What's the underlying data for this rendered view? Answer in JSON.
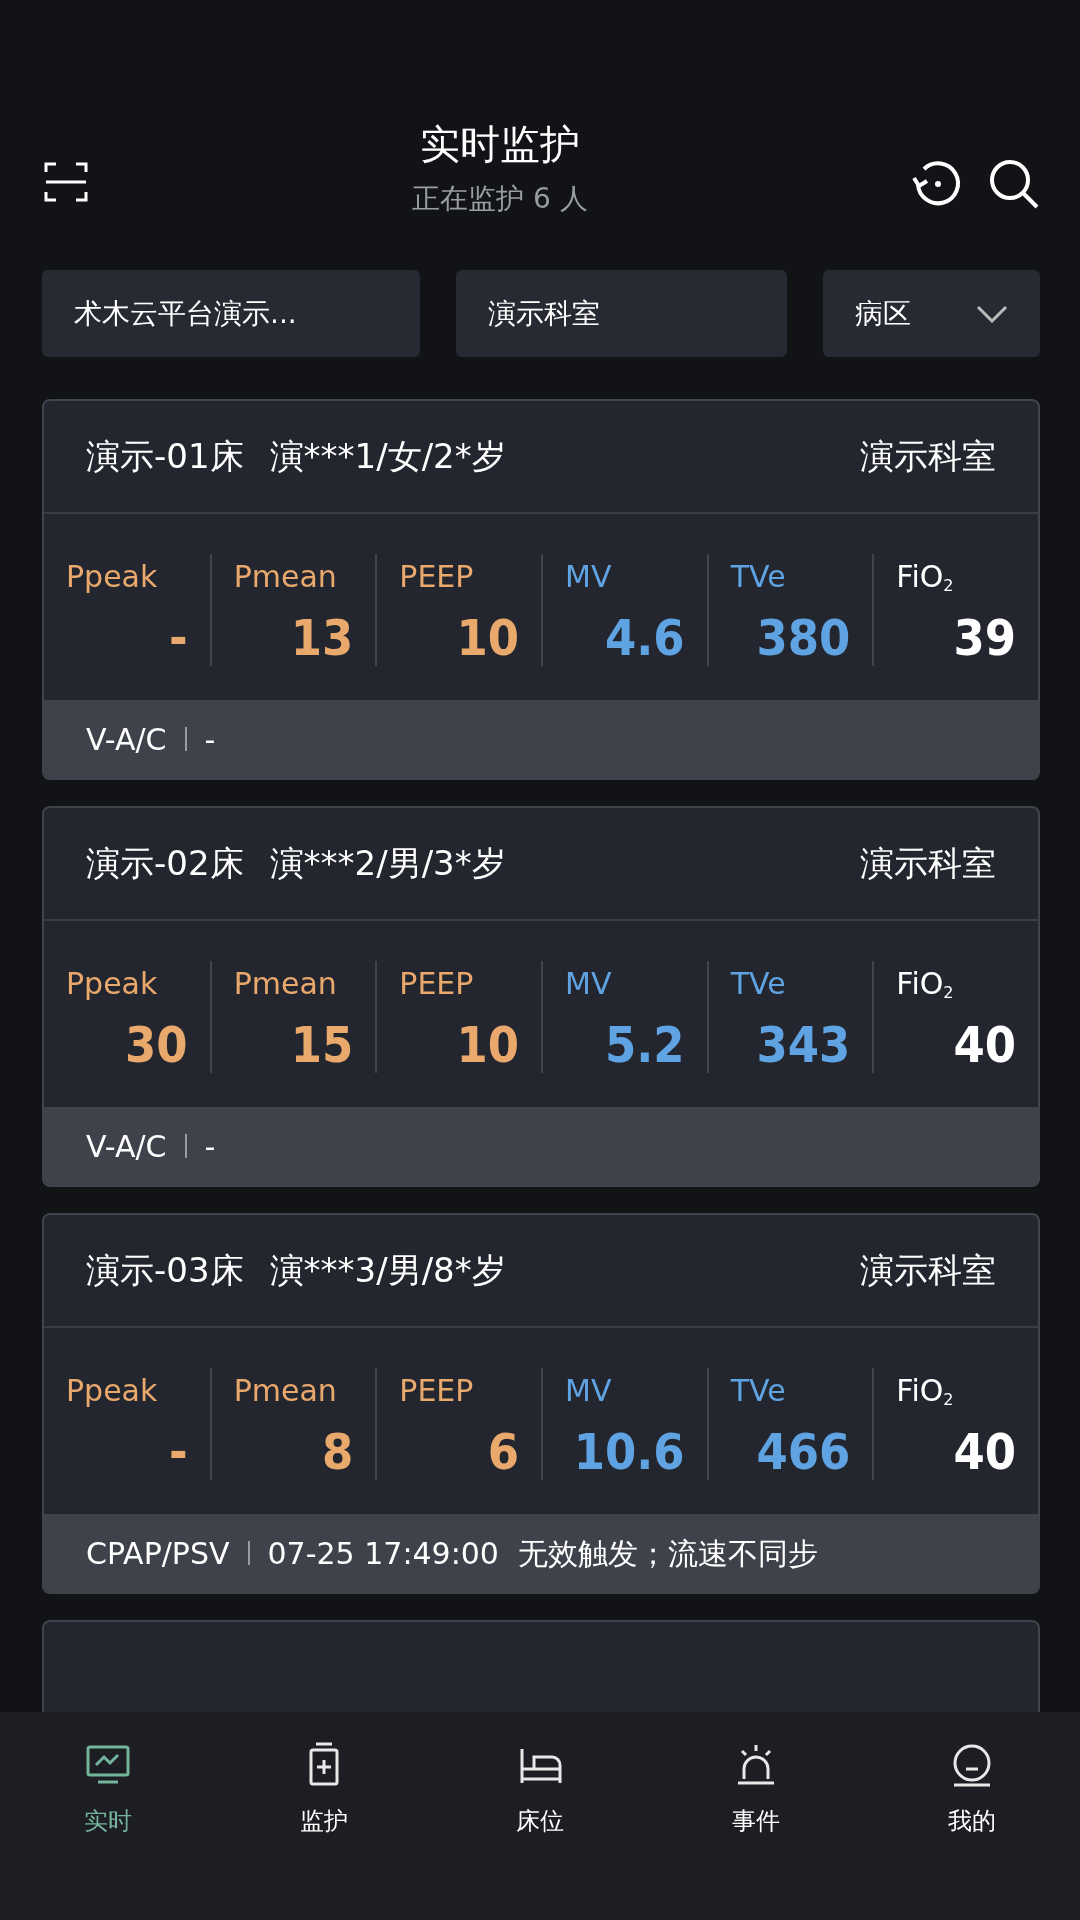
{
  "header": {
    "title": "实时监护",
    "subtitle": "正在监护 6 人"
  },
  "filters": [
    {
      "value": "术木云平台演示...",
      "dropdown": false
    },
    {
      "value": "演示科室",
      "dropdown": false
    },
    {
      "value": "病区",
      "dropdown": true
    }
  ],
  "patients": [
    {
      "bed": "演示-01床",
      "patient": "演***1/女/2*岁",
      "department": "演示科室",
      "metrics": [
        {
          "label": "Ppeak",
          "value": "-",
          "color": "#e9a86c"
        },
        {
          "label": "Pmean",
          "value": "13",
          "color": "#e9a86c"
        },
        {
          "label": "PEEP",
          "value": "10",
          "color": "#e9a86c"
        },
        {
          "label": "MV",
          "value": "4.6",
          "color": "#5fa3e3"
        },
        {
          "label": "TVe",
          "value": "380",
          "color": "#5fa3e3"
        },
        {
          "label": "FiO$_{2}$",
          "value": "39",
          "color": "#ffffff"
        }
      ],
      "mode": "V-A/C",
      "event": "-"
    },
    {
      "bed": "演示-02床",
      "patient": "演***2/男/3*岁",
      "department": "演示科室",
      "metrics": [
        {
          "label": "Ppeak",
          "value": "30",
          "color": "#e9a86c"
        },
        {
          "label": "Pmean",
          "value": "15",
          "color": "#e9a86c"
        },
        {
          "label": "PEEP",
          "value": "10",
          "color": "#e9a86c"
        },
        {
          "label": "MV",
          "value": "5.2",
          "color": "#5fa3e3"
        },
        {
          "label": "TVe",
          "value": "343",
          "color": "#5fa3e3"
        },
        {
          "label": "FiO$_{2}$",
          "value": "40",
          "color": "#ffffff"
        }
      ],
      "mode": "V-A/C",
      "event": "-"
    },
    {
      "bed": "演示-03床",
      "patient": "演***3/男/8*岁",
      "department": "演示科室",
      "metrics": [
        {
          "label": "Ppeak",
          "value": "-",
          "color": "#e9a86c"
        },
        {
          "label": "Pmean",
          "value": "8",
          "color": "#e9a86c"
        },
        {
          "label": "PEEP",
          "value": "6",
          "color": "#e9a86c"
        },
        {
          "label": "MV",
          "value": "10.6",
          "color": "#5fa3e3"
        },
        {
          "label": "TVe",
          "value": "466",
          "color": "#5fa3e3"
        },
        {
          "label": "FiO$_{2}$",
          "value": "40",
          "color": "#ffffff"
        }
      ],
      "mode": "CPAP/PSV",
      "event": "07-25 17:49:00  无效触发；流速不同步"
    }
  ],
  "nav": [
    {
      "label": "实时",
      "kind": "monitor",
      "selected": true
    },
    {
      "label": "监护",
      "kind": "kit",
      "selected": false
    },
    {
      "label": "床位",
      "kind": "bed",
      "selected": false
    },
    {
      "label": "事件",
      "kind": "alarm",
      "selected": false
    },
    {
      "label": "我的",
      "kind": "user",
      "selected": false
    }
  ]
}
